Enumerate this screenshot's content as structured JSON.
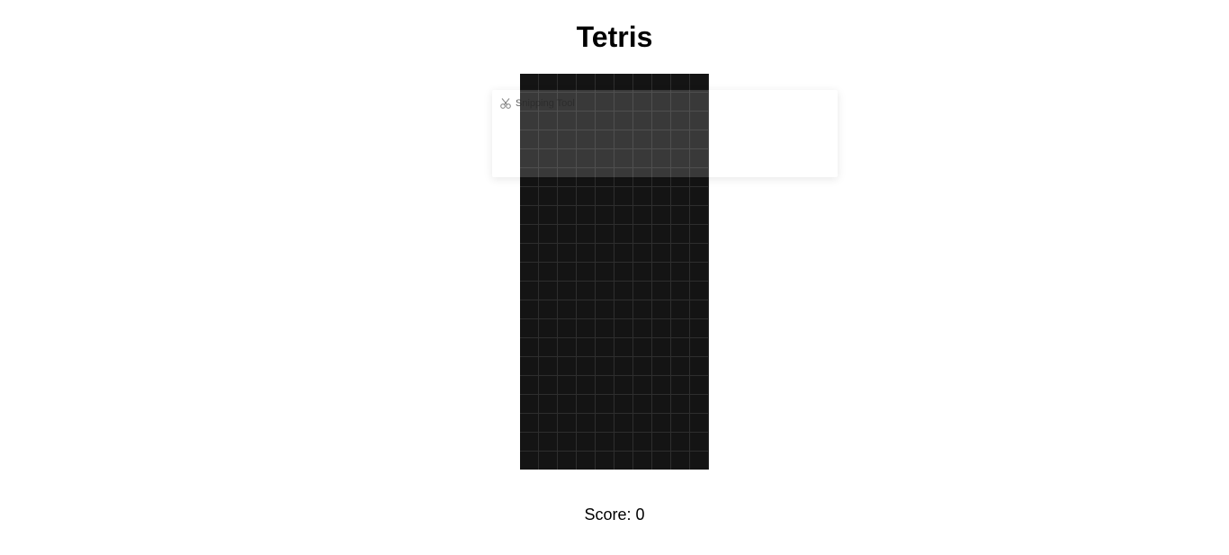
{
  "title": "Tetris",
  "board": {
    "columns": 10,
    "rows": 21,
    "background_color": "#141414",
    "grid_color": "#2e2e2e"
  },
  "overlay": {
    "label": "Snipping Tool",
    "icon": "scissors-icon"
  },
  "score": {
    "label": "Score:",
    "value": "0"
  }
}
